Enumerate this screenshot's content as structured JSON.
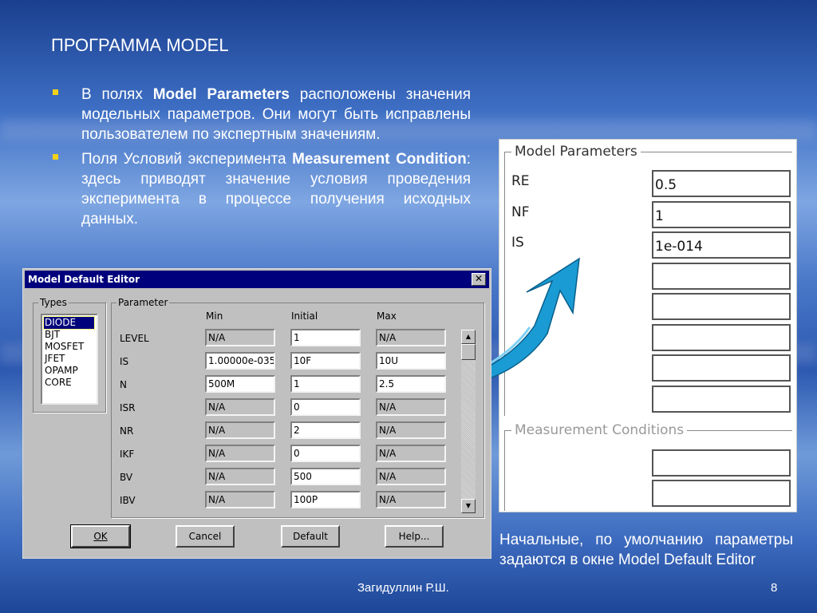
{
  "slide": {
    "title": "ПРОГРАММА MODEL",
    "bullets": [
      {
        "pre": "В полях ",
        "bold": "Model Parameters",
        "post": " расположены значения модельных параметров. Они могут быть исправлены пользователем по экспертным значениям."
      },
      {
        "pre": "Поля Условий эксперимента ",
        "bold": "Measurement Condition",
        "post": ": здесь приводят значение условия проведения эксперимента в процессе получения исходных данных."
      }
    ],
    "caption": "Начальные, по умолчанию параметры задаются в окне Model Default Editor",
    "author": "Загидуллин Р.Ш.",
    "page": "8",
    "colors": {
      "bullet": "#f2d21a",
      "arrow": "#1a9bd4"
    }
  },
  "model_params": {
    "group_title": "Model Parameters",
    "rows": [
      {
        "label": "RE",
        "value": "0.5"
      },
      {
        "label": "NF",
        "value": "1"
      },
      {
        "label": "IS",
        "value": "1e-014"
      },
      {
        "label": "",
        "value": ""
      },
      {
        "label": "",
        "value": ""
      },
      {
        "label": "",
        "value": ""
      },
      {
        "label": "",
        "value": ""
      },
      {
        "label": "",
        "value": ""
      }
    ],
    "measurement_title": "Measurement Conditions",
    "measurement_rows": [
      {
        "value": ""
      },
      {
        "value": ""
      }
    ]
  },
  "dialog": {
    "title": "Model Default Editor",
    "close_icon": "close-x-icon",
    "types_title": "Types",
    "types": [
      "DIODE",
      "BJT",
      "MOSFET",
      "JFET",
      "OPAMP",
      "CORE"
    ],
    "selected_type": "DIODE",
    "parameter_title": "Parameter",
    "col_min": "Min",
    "col_initial": "Initial",
    "col_max": "Max",
    "params": [
      {
        "name": "LEVEL",
        "min": "N/A",
        "initial": "1",
        "max": "N/A"
      },
      {
        "name": "IS",
        "min": "1.00000e-035",
        "initial": "10F",
        "max": "10U"
      },
      {
        "name": "N",
        "min": "500M",
        "initial": "1",
        "max": "2.5"
      },
      {
        "name": "ISR",
        "min": "N/A",
        "initial": "0",
        "max": "N/A"
      },
      {
        "name": "NR",
        "min": "N/A",
        "initial": "2",
        "max": "N/A"
      },
      {
        "name": "IKF",
        "min": "N/A",
        "initial": "0",
        "max": "N/A"
      },
      {
        "name": "BV",
        "min": "N/A",
        "initial": "500",
        "max": "N/A"
      },
      {
        "name": "IBV",
        "min": "N/A",
        "initial": "100P",
        "max": "N/A"
      }
    ],
    "enabled_min": [
      false,
      true,
      true,
      false,
      false,
      false,
      false,
      false
    ],
    "enabled_max": [
      false,
      true,
      true,
      false,
      false,
      false,
      false,
      false
    ],
    "buttons": {
      "ok": "OK",
      "cancel": "Cancel",
      "default": "Default",
      "help": "Help..."
    }
  }
}
